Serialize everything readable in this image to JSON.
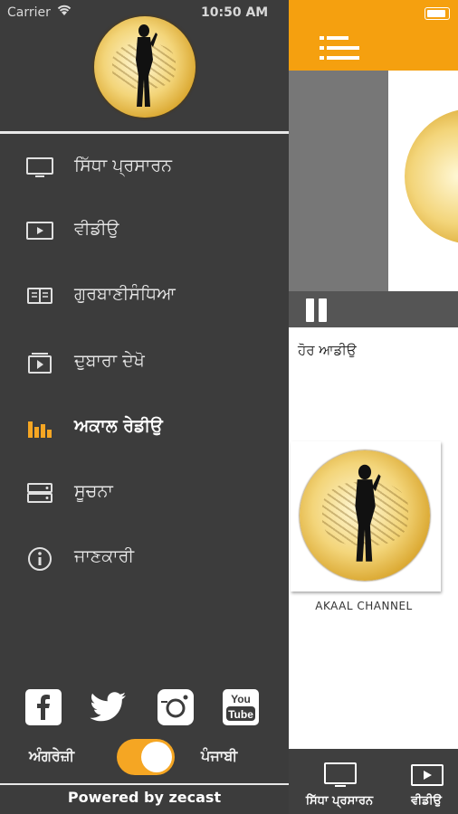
{
  "status_bar": {
    "carrier": "Carrier",
    "time": "10:50 AM"
  },
  "drawer": {
    "menu": [
      {
        "label": "ਸਿੱਧਾ ਪ੍ਰਸਾਰਨ",
        "icon": "tv-icon"
      },
      {
        "label": "ਵੀਡੀਉ",
        "icon": "video-icon"
      },
      {
        "label": "ਗੁਰਬਾਣੀਸੰਧਿਆ",
        "icon": "book-icon"
      },
      {
        "label": "ਦੁਬਾਰਾ ਦੇਖੋ",
        "icon": "replay-icon"
      },
      {
        "label": "ਅਕਾਲ ਰੇਡੀਉ",
        "icon": "radio-equalizer-icon",
        "active": true
      },
      {
        "label": "ਸੂਚਨਾ",
        "icon": "server-icon"
      },
      {
        "label": "ਜਾਣਕਾਰੀ",
        "icon": "info-icon"
      }
    ],
    "social": [
      "facebook-icon",
      "twitter-icon",
      "instagram-icon",
      "youtube-icon"
    ],
    "youtube_text_top": "You",
    "youtube_text_bottom": "Tube",
    "language": {
      "left": "ਅੰਗਰੇਜ਼ੀ",
      "right": "ਪੰਜਾਬੀ",
      "toggle_on": true
    },
    "powered_by": "Powered by zecast"
  },
  "main": {
    "more_videos_title": "ਹੋਰ ਆਡੀਉ",
    "card_title": "AKAAL CHANNEL",
    "tabs": [
      {
        "label": "ਸਿੱਧਾ ਪ੍ਰਸਾਰਨ",
        "icon": "tv-icon"
      },
      {
        "label": "ਵੀਡੀਉ",
        "icon": "video-icon"
      }
    ]
  },
  "colors": {
    "accent": "#f5a00f",
    "drawer_bg": "#3c3c3c",
    "toggle": "#f5a623"
  }
}
